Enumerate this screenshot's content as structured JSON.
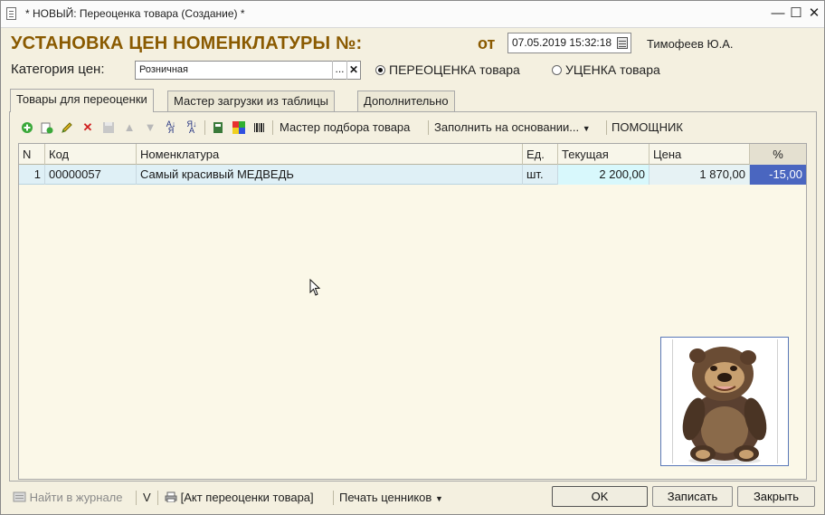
{
  "window": {
    "title": "* НОВЫЙ: Переоценка товара (Создание) *",
    "minimize_glyph": "—",
    "maximize_glyph": "☐",
    "close_glyph": "✕"
  },
  "header": {
    "title": "УСТАНОВКА ЦЕН НОМЕНКЛАТУРЫ №:",
    "date_label": "от",
    "date_value": "07.05.2019 15:32:18",
    "author": "Тимофеев Ю.А.",
    "price_category_label": "Категория цен:",
    "price_category_value": "Розничная",
    "select_button": "...",
    "clear_button": "✕",
    "radio_revaluation": "ПЕРЕОЦЕНКА товара",
    "radio_markdown": "УЦЕНКА товара",
    "selected_radio": "revaluation"
  },
  "tabs": [
    {
      "label": "Товары для переоценки",
      "active": true
    },
    {
      "label": "Мастер загрузки из таблицы",
      "active": false
    },
    {
      "label": "Дополнительно",
      "active": false
    }
  ],
  "toolbar": {
    "icons": [
      "add-icon",
      "copy-icon",
      "edit-icon",
      "delete-icon",
      "save-icon",
      "move-up-icon",
      "move-down-icon",
      "sort-asc-icon",
      "sort-desc-icon",
      "print-icon",
      "color-icon",
      "barcode-icon"
    ],
    "selection_wizard": "Мастер подбора товара",
    "fill_based_on": "Заполнить на основании...",
    "assistant": "ПОМОЩНИК"
  },
  "table": {
    "columns": [
      "N",
      "Код",
      "Номенклатура",
      "Ед.",
      "Текущая",
      "Цена",
      "%"
    ],
    "rows": [
      {
        "n": "1",
        "code": "00000057",
        "name": "Самый красивый МЕДВЕДЬ",
        "unit": "шт.",
        "current": "2 200,00",
        "price": "1 870,00",
        "percent": "-15,00"
      }
    ]
  },
  "colors": {
    "title_accent": "#8a5a00",
    "window_bg": "#f4f0e0",
    "row_highlight": "#dff0f6",
    "current_cell": "#d8f8fc",
    "percent_cell": "#4a66c0"
  },
  "footer": {
    "find_in_journal": "Найти в журнале",
    "v_label": "V",
    "revaluation_act": "[Акт переоценки товара]",
    "print_price_tags": "Печать ценников",
    "ok": "OK",
    "save": "Записать",
    "close": "Закрыть"
  }
}
